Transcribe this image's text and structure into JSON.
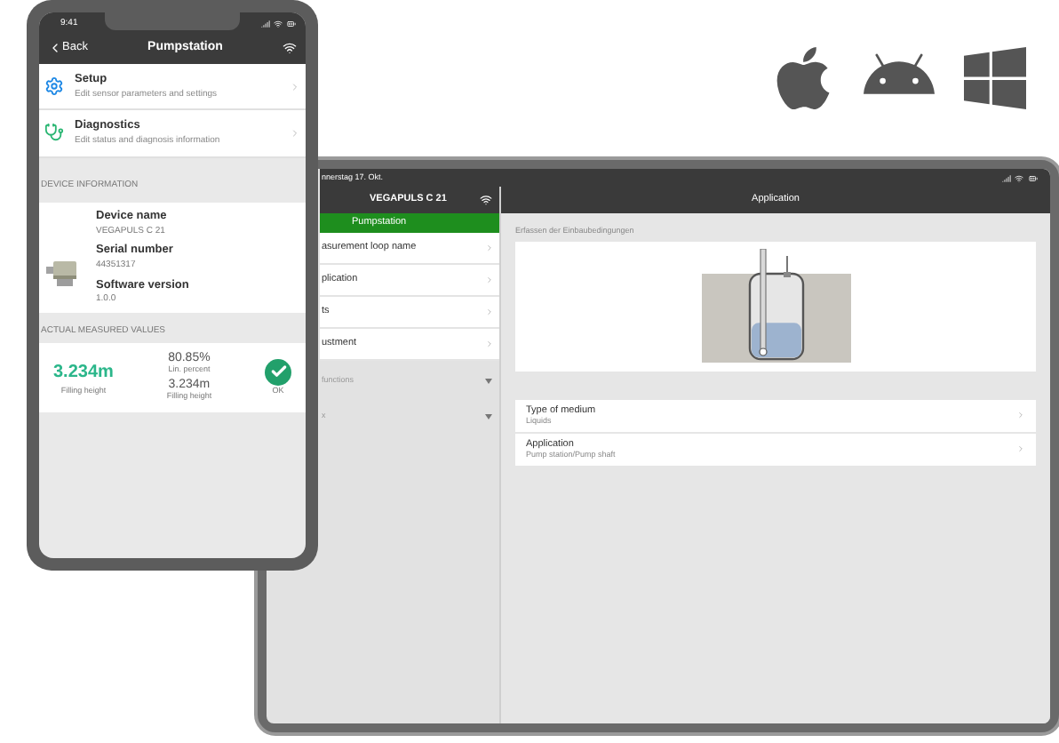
{
  "platforms": [
    {
      "kind": "apple"
    },
    {
      "kind": "android"
    },
    {
      "kind": "windows"
    }
  ],
  "phone": {
    "status_time": "9:41",
    "header": {
      "back_label": "Back",
      "title": "Pumpstation"
    },
    "menu": [
      {
        "kind": "setup",
        "title": "Setup",
        "subtitle": "Edit sensor parameters  and settings"
      },
      {
        "kind": "diagnostics",
        "title": "Diagnostics",
        "subtitle": "Edit status and diagnosis information"
      }
    ],
    "device_section": {
      "heading": "DEVICE INFORMATION",
      "fields": [
        {
          "label": "Device name",
          "value": "VEGAPULS C 21"
        },
        {
          "label": "Serial number",
          "value": "44351317"
        },
        {
          "label": "Software version",
          "value": "1.0.0"
        }
      ]
    },
    "values_section": {
      "heading": "ACTUAL MEASURED VALUES",
      "main": {
        "value": "3.234m",
        "label": "Filling height"
      },
      "secondary": [
        {
          "value": "80.85%",
          "label": "Lin. percent"
        },
        {
          "value": "3.234m",
          "label": "Filling height"
        }
      ],
      "status": {
        "ok": true,
        "label": "OK"
      }
    }
  },
  "tablet": {
    "status_date": "nnerstag 17. Okt.",
    "sidebar": {
      "title": "VEGAPULS C 21",
      "group": "Pumpstation",
      "items": [
        {
          "label": "asurement loop name"
        },
        {
          "label": "plication"
        },
        {
          "label": "ts"
        },
        {
          "label": "ustment"
        }
      ],
      "collapsed": [
        {
          "label": "functions",
          "expanded": false
        },
        {
          "label": "x",
          "expanded": false
        }
      ]
    },
    "main": {
      "title": "Application",
      "caption": "Erfassen der Einbaubedingungen",
      "level": 0.42,
      "rows": [
        {
          "title": "Type of medium",
          "subtitle": "Liquids"
        },
        {
          "title": "Application",
          "subtitle": "Pump station/Pump shaft"
        }
      ]
    }
  }
}
